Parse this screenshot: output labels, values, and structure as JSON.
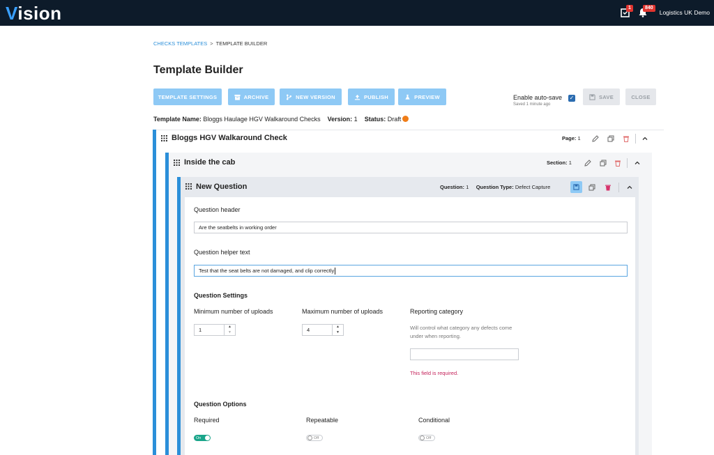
{
  "app": {
    "logo_rest": "ision",
    "logo_first": "V",
    "tasks_badge": "1",
    "notifications_badge": "840",
    "org_name": "Logistics UK Demo"
  },
  "breadcrumb": {
    "parent": "CHECKS TEMPLATES",
    "separator": ">",
    "current": "TEMPLATE BUILDER"
  },
  "page_title": "Template Builder",
  "toolbar": {
    "template_settings": "TEMPLATE SETTINGS",
    "archive": "ARCHIVE",
    "new_version": "NEW VERSION",
    "publish": "PUBLISH",
    "preview": "PREVIEW",
    "autosave_label": "Enable auto-save",
    "autosave_checked": true,
    "saved_note": "Saved 1 minute ago",
    "save": "SAVE",
    "close": "CLOSE"
  },
  "template_meta": {
    "name_label": "Template Name:",
    "name_value": "Bloggs Haulage HGV Walkaround Checks",
    "version_label": "Version:",
    "version_value": "1",
    "status_label": "Status:",
    "status_value": "Draft",
    "status_color": "#f07d18"
  },
  "page": {
    "title": "Bloggs HGV Walkaround Check",
    "counter_label": "Page:",
    "counter_value": "1"
  },
  "section": {
    "title": "Inside the cab",
    "counter_label": "Section:",
    "counter_value": "1"
  },
  "question": {
    "title": "New Question",
    "counter_label": "Question:",
    "counter_value": "1",
    "type_label": "Question Type:",
    "type_value": "Defect Capture",
    "header_label": "Question header",
    "header_value": "Are the seatbelts in working order",
    "helper_label": "Question helper text",
    "helper_value": "Test that the seat belts are not damaged, and clip correctly"
  },
  "settings": {
    "heading": "Question Settings",
    "min_uploads_label": "Minimum number of uploads",
    "min_uploads_value": "1",
    "max_uploads_label": "Maximum number of uploads",
    "max_uploads_value": "4",
    "reporting_label": "Reporting category",
    "reporting_helper": "Will control what category any defects come under when reporting.",
    "reporting_value": "",
    "reporting_error": "This field is required."
  },
  "options": {
    "heading": "Question Options",
    "required_label": "Required",
    "required_state": "On",
    "repeatable_label": "Repeatable",
    "repeatable_state": "Off",
    "conditional_label": "Conditional",
    "conditional_state": "Off"
  },
  "colors": {
    "accent": "#2b8fd9",
    "button_disabled": "#8ec9f5",
    "toggle_on": "#1aa58a",
    "error": "#c4225a",
    "topbar": "#0d1b2a"
  }
}
